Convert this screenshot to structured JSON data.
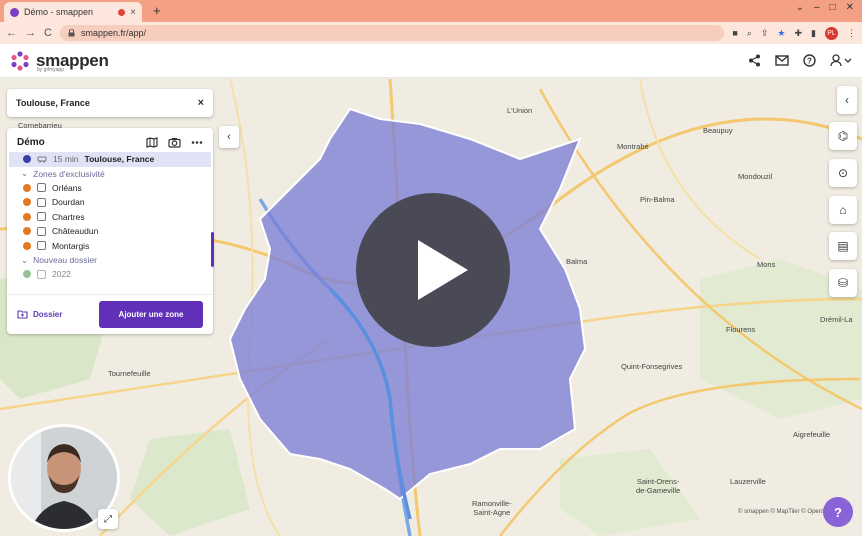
{
  "browser": {
    "tab_title": "Démo - smappen",
    "tab_close": "×",
    "new_tab": "+",
    "window_controls": [
      "⌄",
      "–",
      "□",
      "✕"
    ],
    "url": "smappen.fr/app/",
    "profile_initials": "PL",
    "nav": {
      "back": "←",
      "forward": "→",
      "reload": "C"
    }
  },
  "app": {
    "brand": "smappen",
    "brand_sub": "by gifmyapp"
  },
  "search": {
    "value": "Toulouse, France",
    "close": "×"
  },
  "panel": {
    "title": "Démo",
    "selected_zone": {
      "time": "15 min",
      "place": "Toulouse, France"
    },
    "group1": "Zones d'exclusivité",
    "zones": [
      "Orléans",
      "Dourdan",
      "Chartres",
      "Châteaudun",
      "Montargis"
    ],
    "group2": "Nouveau dossier",
    "zone2": "2022",
    "folder_button": "Dossier",
    "add_button": "Ajouter une zone"
  },
  "colors": {
    "isochrone": "#7b7fd6",
    "accent": "#6030b8",
    "zone_orange": "#e07b22",
    "zone_green": "#3f8f3f",
    "selected_dot": "#3a3fa6"
  },
  "icons": {
    "share": "share-icon",
    "mail": "mail-icon",
    "help": "help-circle-icon",
    "user": "user-icon",
    "map": "map-icon",
    "camera": "camera-icon",
    "more": "more-icon",
    "right_tools": [
      "poi-icon",
      "location-pin-icon",
      "bank-icon",
      "clipboard-icon",
      "database-icon"
    ]
  },
  "map_labels": {
    "lunion": "L'Union",
    "beaupuy": "Beaupuy",
    "montrabe": "Montrabé",
    "mondouzil": "Mondouzil",
    "pinbalma": "Pin-Balma",
    "balma": "Balma",
    "mons": "Mons",
    "flourens": "Flourens",
    "drémont": "Drémil-La",
    "quintfonsegrives": "Quint-Fonsegrives",
    "aigrefeuille": "Aigrefeuille",
    "lauzerville": "Lauzerville",
    "saintorens": "Saint-Orens-\nde-Gameville",
    "ramonville": "Ramonville-\nSaint-Agne",
    "cornebarrieu": "Cornebarrieu",
    "tournefeuille": "Tournefeuille"
  },
  "attribution": "© smappen  © MapTiler  © OpenStreetMap"
}
